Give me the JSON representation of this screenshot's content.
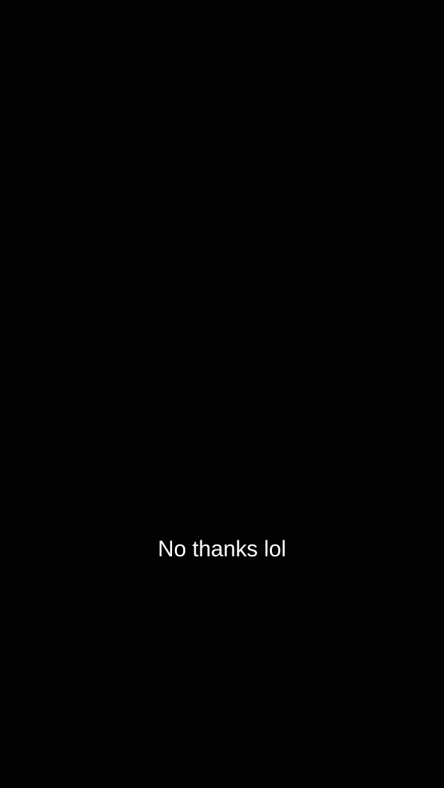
{
  "colors": {
    "background": "#020203",
    "caption_text": "#ffffff"
  },
  "caption": {
    "text": "No thanks lol"
  }
}
